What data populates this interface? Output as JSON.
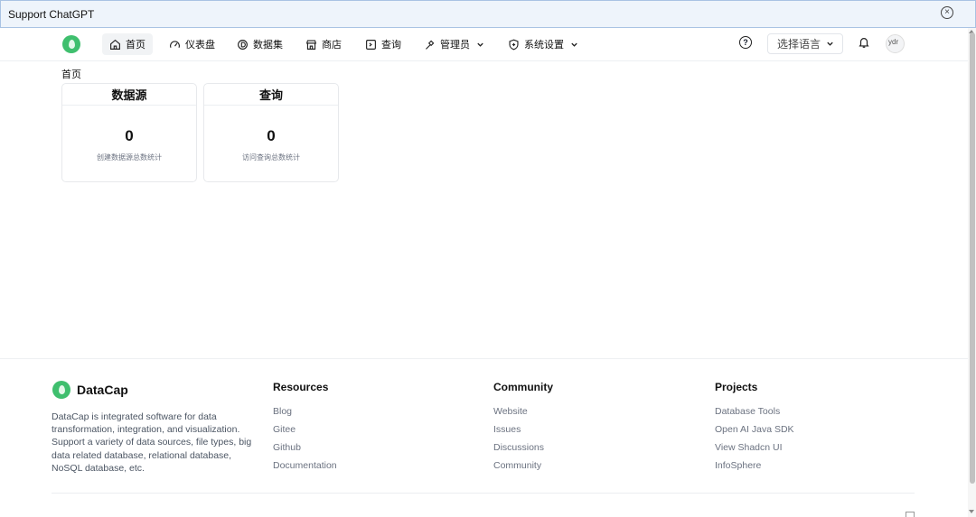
{
  "banner": {
    "text": "Support ChatGPT",
    "close_glyph": "×"
  },
  "nav": {
    "items": [
      {
        "label": "首页",
        "icon": "home-icon",
        "active": true
      },
      {
        "label": "仪表盘",
        "icon": "gauge-icon"
      },
      {
        "label": "数据集",
        "icon": "dataset-icon"
      },
      {
        "label": "商店",
        "icon": "store-icon"
      },
      {
        "label": "查询",
        "icon": "terminal-icon"
      },
      {
        "label": "管理员",
        "icon": "hammer-icon",
        "dropdown": true
      },
      {
        "label": "系统设置",
        "icon": "shield-icon",
        "dropdown": true
      }
    ],
    "help_glyph": "?",
    "language_select": "选择语言",
    "avatar_alt": "ydr"
  },
  "breadcrumb": "首页",
  "cards": [
    {
      "title": "数据源",
      "value": "0",
      "description": "创建数据源总数统计"
    },
    {
      "title": "查询",
      "value": "0",
      "description": "访问查询总数统计"
    }
  ],
  "footer": {
    "brand": "DataCap",
    "description": "DataCap is integrated software for data transformation, integration, and visualization. Support a variety of data sources, file types, big data related database, relational database, NoSQL database, etc.",
    "columns": [
      {
        "title": "Resources",
        "links": [
          "Blog",
          "Gitee",
          "Github",
          "Documentation"
        ]
      },
      {
        "title": "Community",
        "links": [
          "Website",
          "Issues",
          "Discussions",
          "Community"
        ]
      },
      {
        "title": "Projects",
        "links": [
          "Database Tools",
          "Open AI Java SDK",
          "View Shadcn UI",
          "InfoSphere"
        ]
      }
    ]
  },
  "colors": {
    "brand_green": "#3fbf6e",
    "banner_bg": "#eef4fb",
    "active_nav_bg": "#f1f3f5"
  }
}
